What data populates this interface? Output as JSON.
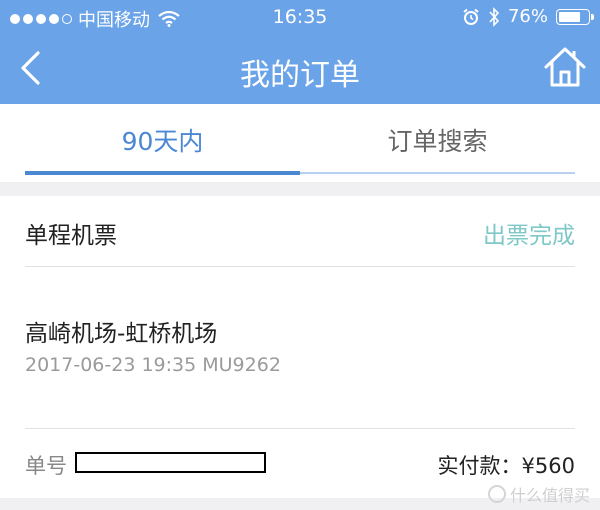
{
  "status_bar": {
    "carrier": "中国移动",
    "time": "16:35",
    "battery_text": "76%",
    "battery_level": 0.76,
    "signal_bars_filled": 4,
    "signal_bars_total": 5
  },
  "navbar": {
    "title": "我的订单",
    "back_icon": "chevron-left-icon",
    "home_icon": "home-icon"
  },
  "tabs": [
    {
      "label": "90天内",
      "active": true
    },
    {
      "label": "订单搜索",
      "active": false
    }
  ],
  "order": {
    "type": "单程机票",
    "status": "出票完成",
    "route": "高崎机场-虹桥机场",
    "detail": "2017-06-23 19:35 MU9262",
    "order_no_label": "单号",
    "paid_label": "实付款：",
    "paid_amount": "¥560"
  },
  "watermark": {
    "text": "什么值得买"
  },
  "colors": {
    "header": "#6aa3e8",
    "tab_active": "#4a88d4",
    "status_ok": "#7ec8c8"
  }
}
